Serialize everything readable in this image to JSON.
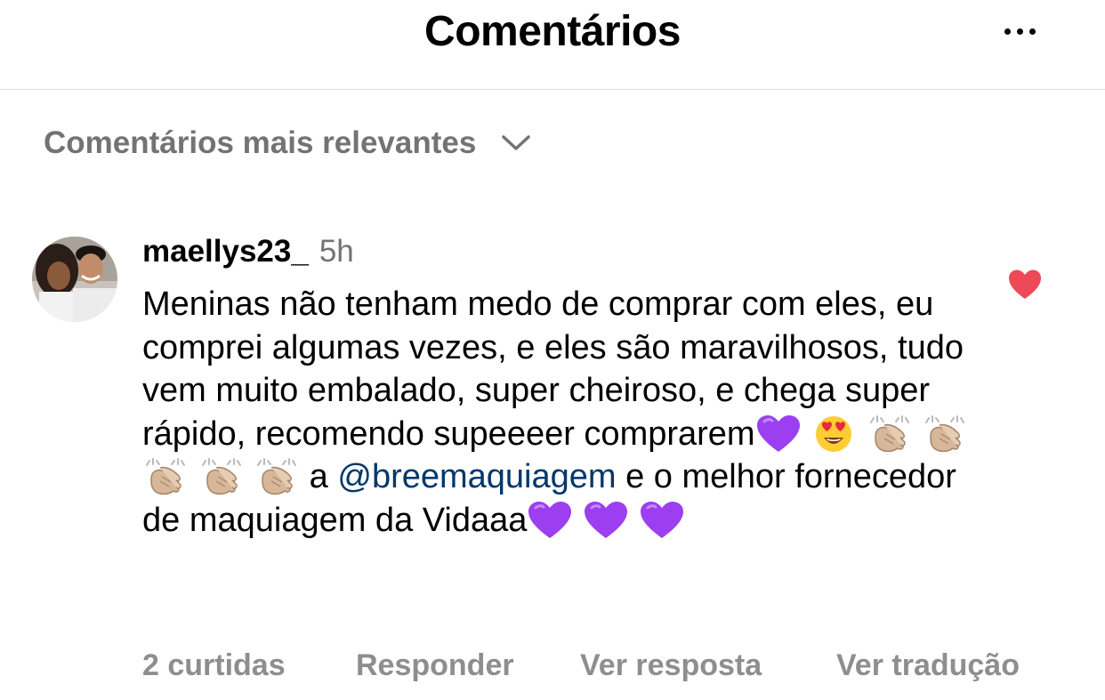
{
  "header": {
    "title": "Comentários",
    "more_icon": "more-horizontal-icon"
  },
  "sort": {
    "label": "Comentários mais relevantes",
    "icon": "chevron-down-icon"
  },
  "comment": {
    "avatar_icon": "avatar",
    "username": "maellys23_",
    "time": "5h",
    "text_parts": {
      "p1": "Meninas não tenham medo de comprar com eles, eu comprei algumas vezes, e eles são maravilhosos, tudo vem muito embalado, super cheiroso, e chega super rápido, recomendo supeeeer comprarem",
      "p2": " a ",
      "mention": "@breemaquiagem",
      "p3": " e o melhor fornecedor de maquiagem da Vidaaa"
    },
    "emojis": [
      "purple-heart",
      "heart-eyes",
      "clap",
      "clap",
      "clap",
      "clap",
      "clap",
      "purple-heart",
      "purple-heart",
      "purple-heart"
    ],
    "liked": true,
    "like_color": "#ed4956"
  },
  "actions": {
    "likes": "2 curtidas",
    "reply": "Responder",
    "view_replies": "Ver resposta",
    "translate": "Ver tradução"
  },
  "colors": {
    "secondary_text": "#737373",
    "action_text": "#8e8e8e",
    "mention": "#00376b",
    "divider": "#dbdbdb",
    "purple_heart": "#9b3ff0"
  }
}
